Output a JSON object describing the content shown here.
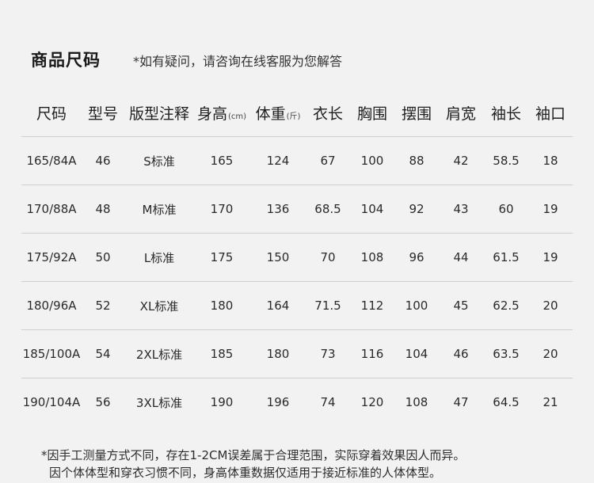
{
  "header": {
    "title": "商品尺码",
    "contact_note": "*如有疑问，请咨询在线客服为您解答"
  },
  "table": {
    "columns": [
      {
        "label": "尺码",
        "unit": ""
      },
      {
        "label": "型号",
        "unit": ""
      },
      {
        "label": "版型注释",
        "unit": ""
      },
      {
        "label": "身高",
        "unit": "(cm)"
      },
      {
        "label": "体重",
        "unit": "(斤)"
      },
      {
        "label": "衣长",
        "unit": ""
      },
      {
        "label": "胸围",
        "unit": ""
      },
      {
        "label": "摆围",
        "unit": ""
      },
      {
        "label": "肩宽",
        "unit": ""
      },
      {
        "label": "袖长",
        "unit": ""
      },
      {
        "label": "袖口",
        "unit": ""
      }
    ],
    "rows": [
      [
        "165/84A",
        "46",
        "S标准",
        "165",
        "124",
        "67",
        "100",
        "88",
        "42",
        "58.5",
        "18"
      ],
      [
        "170/88A",
        "48",
        "M标准",
        "170",
        "136",
        "68.5",
        "104",
        "92",
        "43",
        "60",
        "19"
      ],
      [
        "175/92A",
        "50",
        "L标准",
        "175",
        "150",
        "70",
        "108",
        "96",
        "44",
        "61.5",
        "19"
      ],
      [
        "180/96A",
        "52",
        "XL标准",
        "180",
        "164",
        "71.5",
        "112",
        "100",
        "45",
        "62.5",
        "20"
      ],
      [
        "185/100A",
        "54",
        "2XL标准",
        "185",
        "180",
        "73",
        "116",
        "104",
        "46",
        "63.5",
        "20"
      ],
      [
        "190/104A",
        "56",
        "3XL标准",
        "190",
        "196",
        "74",
        "120",
        "108",
        "47",
        "64.5",
        "21"
      ]
    ]
  },
  "footer": {
    "notes": [
      "*因手工测量方式不同，存在1-2CM误差属于合理范围，实际穿着效果因人而异。",
      "因个体体型和穿衣习惯不同，身高体重数据仅适用于接近标准的人体体型。"
    ]
  }
}
